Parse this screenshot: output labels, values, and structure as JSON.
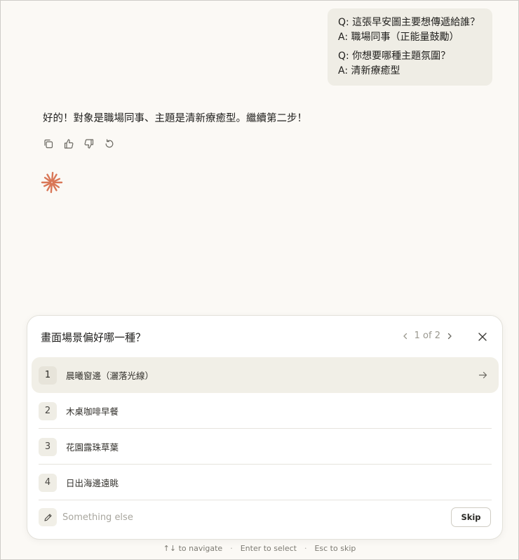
{
  "conversation": {
    "user_message": [
      {
        "q": "Q: 這張早安圖主要想傳遞給誰？",
        "a": "A: 職場同事（正能量鼓勵）"
      },
      {
        "q": "Q: 你想要哪種主題氛圍？",
        "a": "A: 清新療癒型"
      }
    ],
    "assistant_message": "好的！對象是職場同事、主題是清新療癒型。繼續第二步！",
    "actions": [
      "copy-icon",
      "thumbs-up-icon",
      "thumbs-down-icon",
      "retry-icon"
    ],
    "accent_color": "#d97757"
  },
  "question_card": {
    "title": "畫面場景偏好哪一種？",
    "pager": "1 of 2",
    "options": [
      {
        "num": "1",
        "label": "晨曦窗邊（灑落光線）"
      },
      {
        "num": "2",
        "label": "木桌咖啡早餐"
      },
      {
        "num": "3",
        "label": "花園露珠草葉"
      },
      {
        "num": "4",
        "label": "日出海邊遠眺"
      }
    ],
    "highlighted_option": 1,
    "other_placeholder": "Something else",
    "skip_label": "Skip"
  },
  "hints": {
    "navigate": "↑↓ to navigate",
    "select": "Enter to select",
    "escape": "Esc to skip"
  }
}
